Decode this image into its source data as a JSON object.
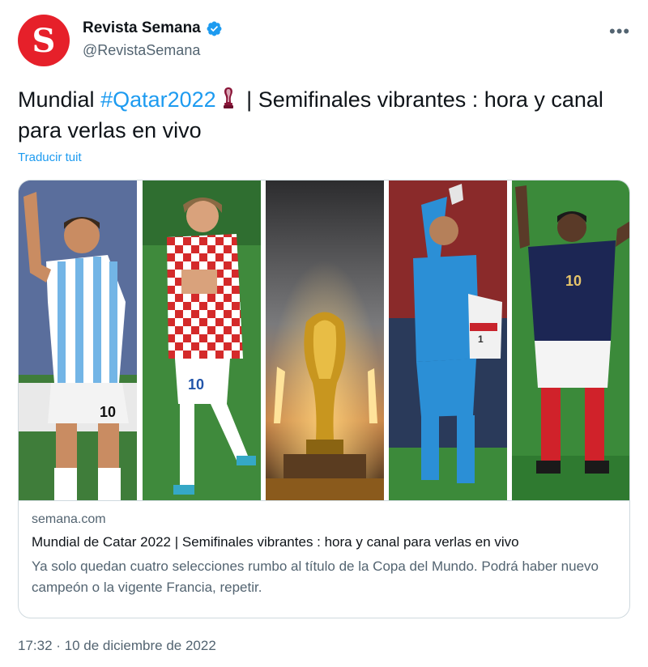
{
  "author": {
    "avatar_letter": "S",
    "name": "Revista Semana",
    "handle": "@RevistaSemana",
    "verified": true
  },
  "more_icon": "more-horizontal-icon",
  "tweet": {
    "text_before": "Mundial ",
    "hashtag": "#Qatar2022",
    "text_after": " | Semifinales vibrantes : hora y canal para verlas en vivo",
    "translate_label": "Traducir tuit"
  },
  "card": {
    "domain": "semana.com",
    "title": "Mundial de Catar 2022 | Semifinales vibrantes : hora y canal para verlas en vivo",
    "description": "Ya solo quedan cuatro selecciones rumbo al título de la Copa del Mundo. Podrá haber nuevo campeón o la vigente Francia, repetir.",
    "photo_numbers": [
      "10",
      "10",
      "1",
      "10"
    ]
  },
  "timestamp": "17:32 · 10 de diciembre de 2022",
  "colors": {
    "accent": "#1d9bf0",
    "brand": "#e6202a",
    "secondary_text": "#536471",
    "border": "#cfd9de"
  }
}
